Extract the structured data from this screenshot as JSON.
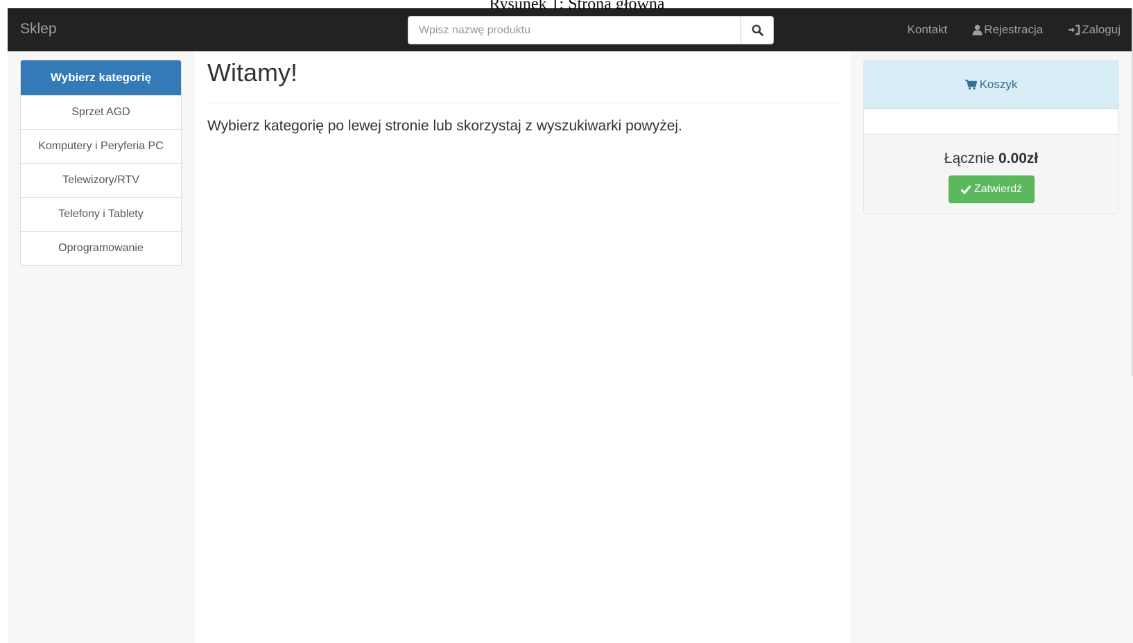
{
  "caption": "Rysunek 1: Strona główna",
  "navbar": {
    "brand": "Sklep",
    "search_placeholder": "Wpisz nazwę produktu",
    "search_icon": "search-icon",
    "links": {
      "contact": "Kontakt",
      "register": "Rejestracja",
      "register_icon": "user-icon",
      "login": "Zaloguj",
      "login_icon": "login-icon"
    }
  },
  "sidebar": {
    "header": "Wybierz kategorię",
    "items": [
      {
        "label": "Sprzet AGD"
      },
      {
        "label": "Komputery i Peryferia PC"
      },
      {
        "label": "Telewizory/RTV"
      },
      {
        "label": "Telefony i Tablety"
      },
      {
        "label": "Oprogramowanie"
      }
    ]
  },
  "main": {
    "title": "Witamy!",
    "text": "Wybierz kategorię po lewej stronie lub skorzystaj z wyszukiwarki powyżej."
  },
  "cart": {
    "title": "Koszyk",
    "title_icon": "cart-icon",
    "total_label": "Łącznie",
    "total_value": "0.00zł",
    "confirm_label": "Zatwierdź",
    "confirm_icon": "check-icon"
  },
  "colors": {
    "navbar_bg": "#222222",
    "primary": "#337ab7",
    "info_bg": "#d9edf7",
    "info_text": "#31708f",
    "success": "#5cb85c"
  }
}
